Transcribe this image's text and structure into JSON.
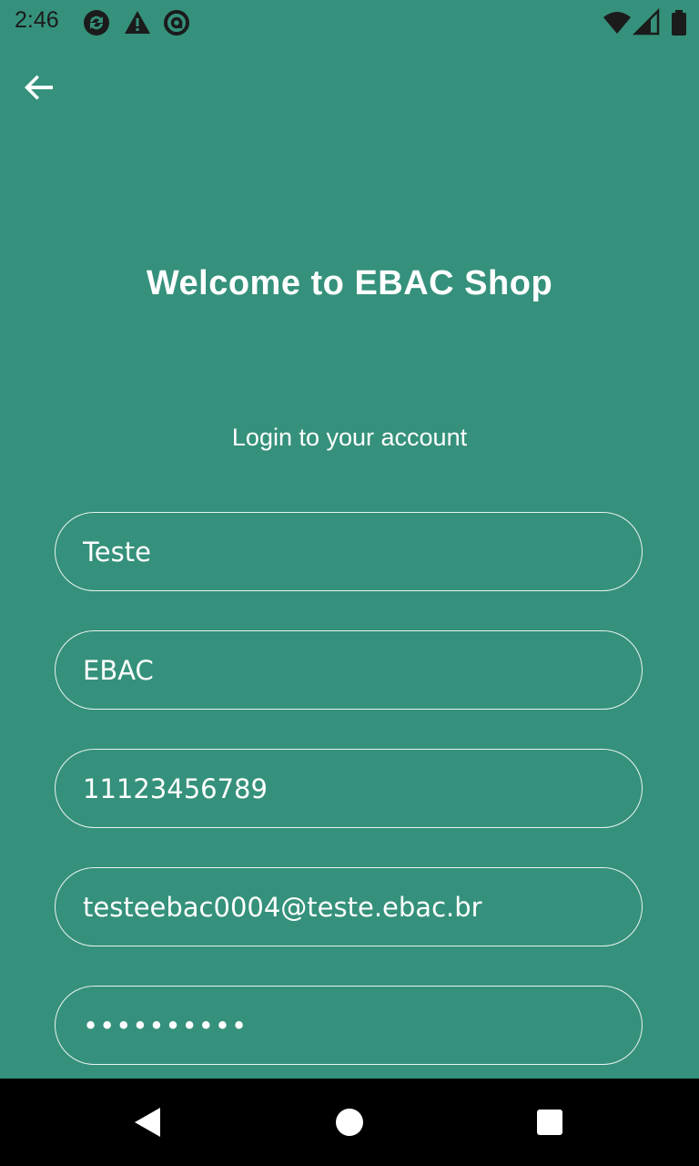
{
  "status_bar": {
    "time": "2:46",
    "icons": [
      "sync-icon",
      "warning-icon",
      "at-sign-icon",
      "wifi-icon",
      "signal-icon",
      "battery-icon"
    ]
  },
  "app_bar": {
    "back_icon": "arrow-back-icon"
  },
  "screen": {
    "title": "Welcome to EBAC Shop",
    "subtitle": "Login to your account"
  },
  "form": {
    "first_name": "Teste",
    "last_name": "EBAC",
    "phone": "11123456789",
    "email": "testeebac0004@teste.ebac.br",
    "password": "••••••••••"
  },
  "nav_bar": {
    "icons": [
      "back-triangle-icon",
      "home-circle-icon",
      "recents-square-icon"
    ]
  },
  "colors": {
    "background": "#35917b",
    "text": "#ffffff",
    "nav_bar": "#000000"
  }
}
